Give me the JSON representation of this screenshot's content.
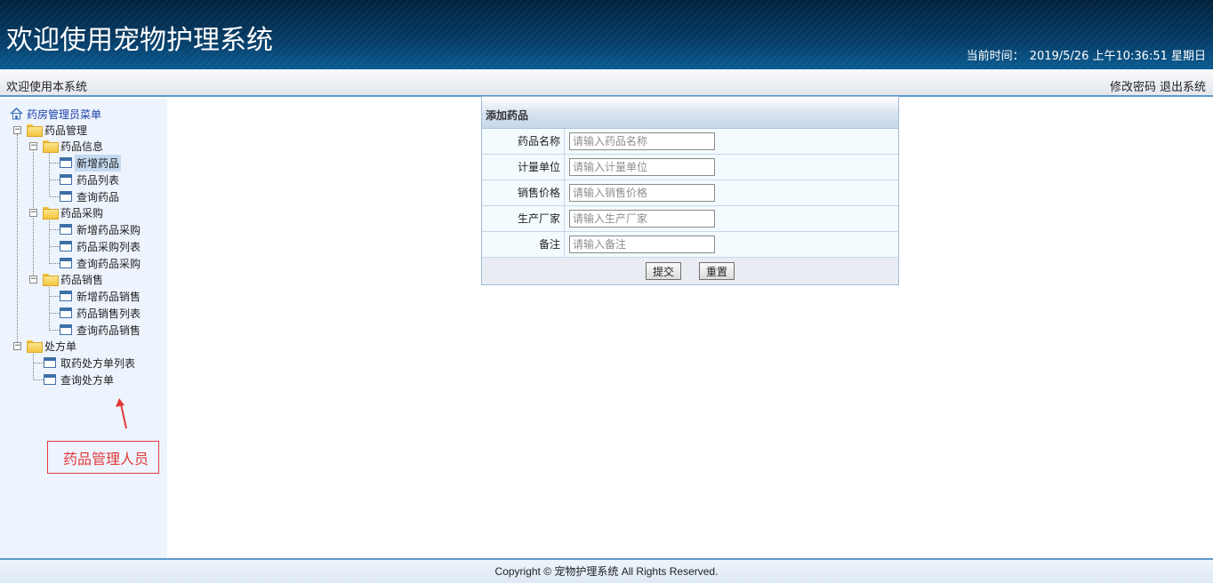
{
  "header": {
    "title": "欢迎使用宠物护理系统",
    "time_label": "当前时间：",
    "time_value": "2019/5/26 上午10:36:51 星期日"
  },
  "welcome_bar": {
    "text": "欢迎使用本系统",
    "change_password": "修改密码",
    "logout": "退出系统"
  },
  "sidebar": {
    "root": "药房管理员菜单",
    "groups": [
      {
        "label": "药品管理"
      },
      {
        "label": "药品信息",
        "items": [
          "新增药品",
          "药品列表",
          "查询药品"
        ]
      },
      {
        "label": "药品采购",
        "items": [
          "新增药品采购",
          "药品采购列表",
          "查询药品采购"
        ]
      },
      {
        "label": "药品销售",
        "items": [
          "新增药品销售",
          "药品销售列表",
          "查询药品销售"
        ]
      },
      {
        "label": "处方单",
        "items": [
          "取药处方单列表",
          "查询处方单"
        ]
      }
    ],
    "selected_item": "新增药品",
    "annotation": "药品管理人员"
  },
  "form": {
    "title": "添加药品",
    "fields": [
      {
        "label": "药品名称",
        "placeholder": "请输入药品名称"
      },
      {
        "label": "计量单位",
        "placeholder": "请输入计量单位"
      },
      {
        "label": "销售价格",
        "placeholder": "请输入销售价格"
      },
      {
        "label": "生产厂家",
        "placeholder": "请输入生产厂家"
      },
      {
        "label": "备注",
        "placeholder": "请输入备注"
      }
    ],
    "submit_label": "提交",
    "reset_label": "重置"
  },
  "footer": {
    "copyright": "Copyright © 宠物护理系统 All Rights Reserved."
  },
  "colors": {
    "header_dark": "#02223c",
    "header_light": "#0a5b92",
    "sidebar_bg": "#eef4fd",
    "accent_line": "#5d98c9",
    "annotation_red": "#e23a3a"
  }
}
